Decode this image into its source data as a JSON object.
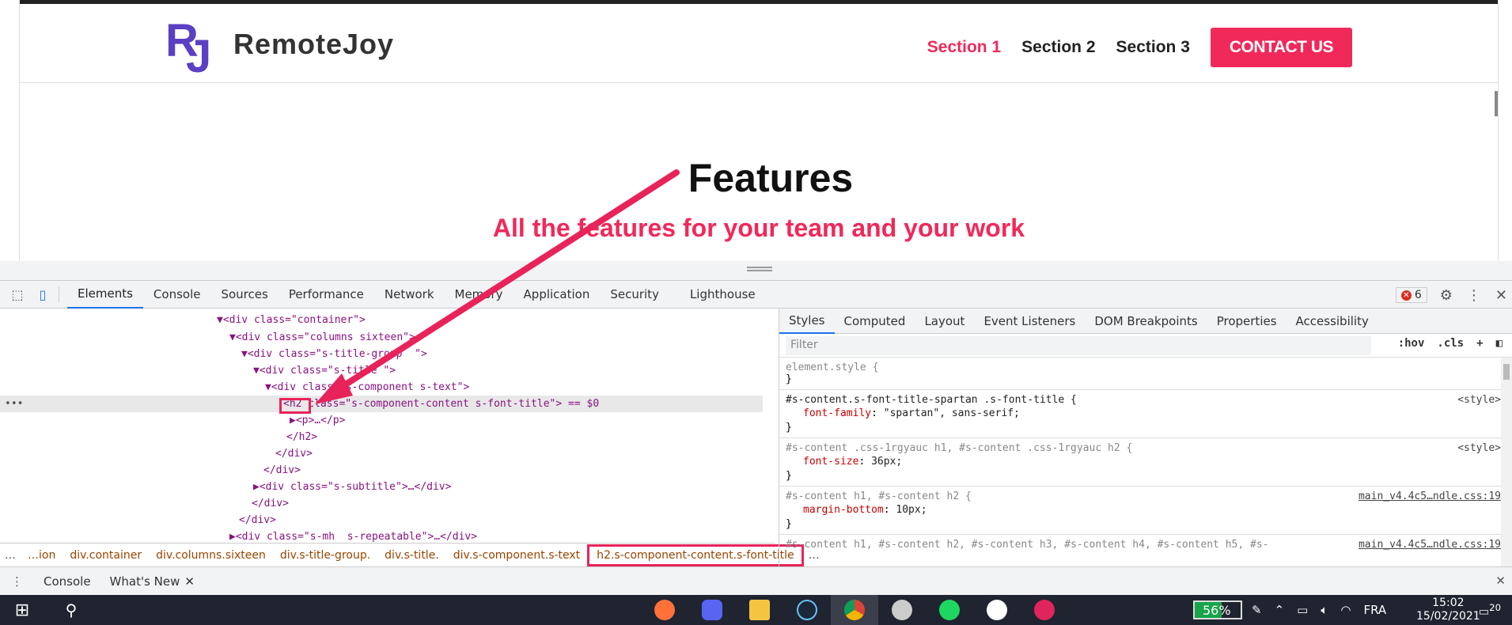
{
  "site": {
    "logo_mark": "RJ",
    "logo_text": "RemoteJoy",
    "nav": [
      "Section 1",
      "Section 2",
      "Section 3"
    ],
    "contact": "CONTACT US",
    "title": "Features",
    "subtitle": "All the features for your team and your work",
    "accent": "#f0295a"
  },
  "devtools": {
    "tabs": [
      "Elements",
      "Console",
      "Sources",
      "Performance",
      "Network",
      "Memory",
      "Application",
      "Security",
      "Lighthouse"
    ],
    "error_count": "6",
    "elements": [
      {
        "t": "▼<div class=\"container\">"
      },
      {
        "t": "▼<div class=\"columns sixteen\">"
      },
      {
        "t": "▼<div class=\"s-title-group  \">"
      },
      {
        "t": "▼<div class=\"s-title \">"
      },
      {
        "t": "▼<div class=\"s-component s-text\">"
      },
      {
        "t": "<h2 class=\"s-component-content s-font-title\"> == $0"
      },
      {
        "t": "▶<p>…</p>"
      },
      {
        "t": "</h2>"
      },
      {
        "t": "</div>"
      },
      {
        "t": "</div>"
      },
      {
        "t": "▶<div class=\"s-subtitle\">…</div>"
      },
      {
        "t": "</div>"
      },
      {
        "t": "</div>"
      },
      {
        "t": "▶<div class=\"s-mh  s-repeatable\">…</div>"
      }
    ],
    "crumbs": [
      "…ion",
      "div.container",
      "div.columns.sixteen",
      "div.s-title-group.",
      "div.s-title.",
      "div.s-component.s-text",
      "h2.s-component-content.s-font-title"
    ],
    "styles_tabs": [
      "Styles",
      "Computed",
      "Layout",
      "Event Listeners",
      "DOM Breakpoints",
      "Properties",
      "Accessibility"
    ],
    "filter_placeholder": "Filter",
    "filter_hov": ":hov",
    "filter_cls": ".cls",
    "rules": [
      {
        "sel": "element.style {",
        "props": [],
        "src": ""
      },
      {
        "sel": "#s-content.s-font-title-spartan .s-font-title {",
        "props": [
          [
            "font-family",
            "\"spartan\", sans-serif;"
          ]
        ],
        "src": "<style>"
      },
      {
        "sel": "#s-content .css-1rgyauc h1, #s-content .css-1rgyauc h2 {",
        "props": [
          [
            "font-size",
            "36px;"
          ]
        ],
        "src": "<style>"
      },
      {
        "sel": "#s-content h1, #s-content h2 {",
        "props": [
          [
            "margin-bottom",
            "10px;"
          ]
        ],
        "src": "main_v4.4c5…ndle.css:19"
      },
      {
        "sel": "#s-content h1, #s-content h2, #s-content h3, #s-content h4, #s-content h5, #s-",
        "props": [],
        "src": "main_v4.4c5…ndle.css:19"
      }
    ],
    "drawer_tabs": [
      "Console",
      "What's New"
    ]
  },
  "taskbar": {
    "battery": "56%",
    "lang": "FRA",
    "time": "15:02",
    "date": "15/02/2021",
    "notif": "20"
  }
}
